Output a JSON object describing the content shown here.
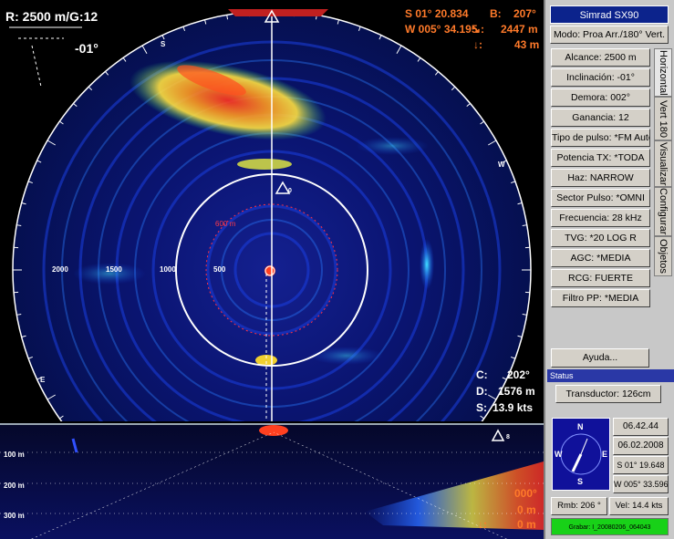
{
  "title": "Simrad SX90",
  "mode": "Modo: Proa Arr./180° Vert.",
  "overlay": {
    "range_gain": "R: 2500 m/G:12",
    "tilt": "-01°",
    "pos_lat": "S  01° 20.834",
    "bearing_label": "B:",
    "bearing_value": "207°",
    "pos_lon": "W 005° 34.195",
    "dist_icon": "↘:",
    "dist_value": "2447 m",
    "depth_icon": "↓:",
    "depth_value": "43 m",
    "course_label": "C:",
    "course_value": "202°",
    "d_label": "D:",
    "d_value": "1576 m",
    "speed_label": "S:",
    "speed_value": "13.9 kts",
    "circle_label": "600 m",
    "marker_0": "0",
    "marker_8": "8"
  },
  "range_labels": [
    "2000",
    "1500",
    "1000",
    "500"
  ],
  "compass_letters": [
    "S",
    "W",
    "E"
  ],
  "vertical": {
    "depth_labels": [
      "100 m",
      "200 m",
      "300 m"
    ],
    "angle": "000°",
    "v1": "0 m",
    "v2_icon": "↓:",
    "v2": "0 m"
  },
  "params": [
    "Alcance: 2500 m",
    "Inclinación: -01°",
    "Demora: 002°",
    "Ganancia: 12",
    "Tipo de pulso: *FM Auto",
    "Potencia TX: *TODA",
    "Haz: NARROW",
    "Sector Pulso: *OMNI",
    "Frecuencia: 28 kHz",
    "TVG: *20 LOG R",
    "AGC: *MEDIA",
    "RCG: FUERTE",
    "Filtro PP: *MEDIA"
  ],
  "tabs": [
    "Horizontal",
    "Vert 180",
    "Visualizar",
    "Configurar",
    "Objetos"
  ],
  "help": "Ayuda...",
  "status": {
    "header": "Status",
    "transducer": "Transductor: 126cm",
    "time": "06.42.44",
    "date": "06.02.2008",
    "lat": "S  01° 19.648",
    "lon": "W 005° 33.596",
    "compass_n": "N",
    "compass_s": "S",
    "compass_e": "E",
    "compass_w": "W",
    "rmb": "Rmb: 206 °",
    "vel": "Vel: 14.4 kts",
    "recording": "Grabar: I_20080206_064043"
  },
  "colors": {
    "accent": "#0c238c",
    "overlay_orange": "#ff7a2a",
    "record_green": "#18d118"
  }
}
